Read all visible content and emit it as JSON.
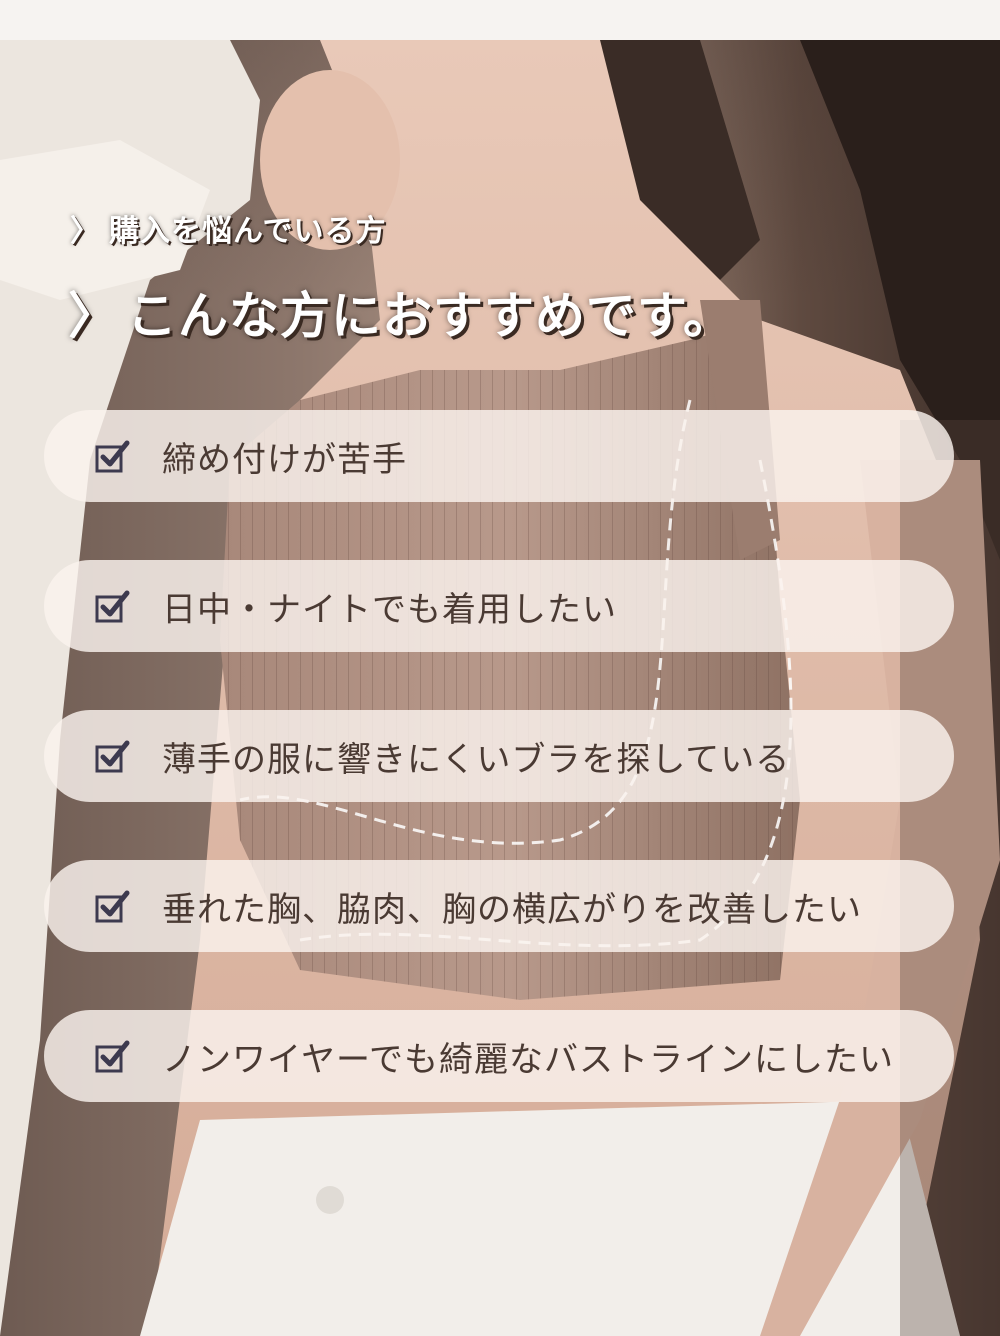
{
  "header": {
    "subtitle": "購入を悩んでいる方",
    "subtitle_chevron": "〉",
    "headline": "こんな方におすすめです。",
    "headline_chevron": "〉"
  },
  "checklist": {
    "icon": "checkbox-checked-icon",
    "items": [
      {
        "label": "締め付けが苦手"
      },
      {
        "label": "日中・ナイトでも着用したい"
      },
      {
        "label": "薄手の服に響きにくいブラを探している"
      },
      {
        "label": "垂れた胸、脇肉、胸の横広がりを改善したい"
      },
      {
        "label": "ノンワイヤーでも綺麗なバストラインにしたい"
      }
    ]
  },
  "colors": {
    "card_bg": "#faf3ee",
    "text": "#4a3a33",
    "heading_shadow": "#3a2a22"
  }
}
